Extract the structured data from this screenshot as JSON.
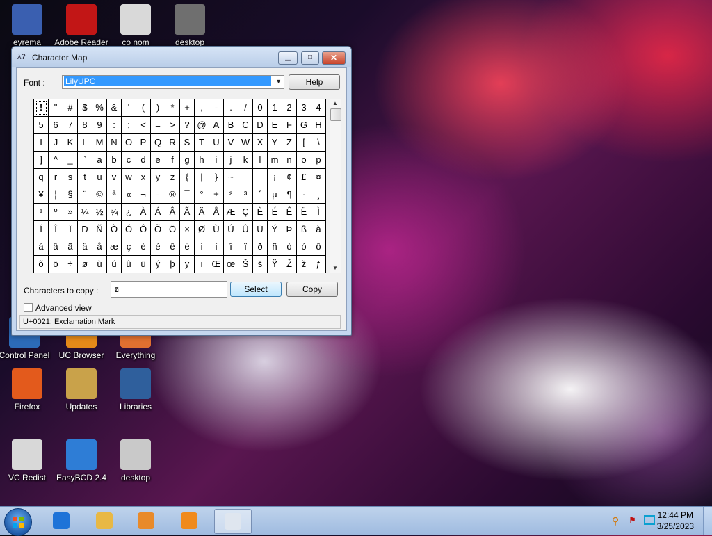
{
  "desktop": {
    "icons": [
      {
        "label": "eyrema",
        "color": "#3a5fb0"
      },
      {
        "label": "Adobe Reader",
        "color": "#c21616"
      },
      {
        "label": "co nom",
        "color": "#d9d9d9"
      },
      {
        "label": "desktop",
        "color": "#6f6f6f"
      },
      {
        "label": "Control Panel",
        "color": "#2c6bb8"
      },
      {
        "label": "UC Browser",
        "color": "#e58a19"
      },
      {
        "label": "Everything",
        "color": "#e07030"
      },
      {
        "label": "Firefox",
        "color": "#e35a1c"
      },
      {
        "label": "Updates",
        "color": "#c9a24a"
      },
      {
        "label": "Libraries",
        "color": "#2f5f9c"
      },
      {
        "label": "VC Redist",
        "color": "#d8d8d8"
      },
      {
        "label": "EasyBCD 2.4",
        "color": "#2e7dd6"
      },
      {
        "label": "desktop",
        "color": "#c9c9c9"
      }
    ]
  },
  "window": {
    "title": "Character Map",
    "icon_glyph": "λ?",
    "controls": {
      "minimize": "▁",
      "maximize": "□",
      "close": "✕"
    },
    "font_label": "Font :",
    "font_value": "LilyUPC",
    "help_label": "Help",
    "chars": [
      [
        "!",
        "\"",
        "#",
        "$",
        "%",
        "&",
        "'",
        "(",
        ")",
        "*",
        "+",
        ",",
        "-",
        ".",
        "/",
        "0",
        "1",
        "2",
        "3",
        "4"
      ],
      [
        "5",
        "6",
        "7",
        "8",
        "9",
        ":",
        ";",
        "<",
        "=",
        ">",
        "?",
        "@",
        "A",
        "B",
        "C",
        "D",
        "E",
        "F",
        "G",
        "H"
      ],
      [
        "I",
        "J",
        "K",
        "L",
        "M",
        "N",
        "O",
        "P",
        "Q",
        "R",
        "S",
        "T",
        "U",
        "V",
        "W",
        "X",
        "Y",
        "Z",
        "[",
        "\\"
      ],
      [
        "]",
        "^",
        "_",
        "`",
        "a",
        "b",
        "c",
        "d",
        "e",
        "f",
        "g",
        "h",
        "i",
        "j",
        "k",
        "l",
        "m",
        "n",
        "o",
        "p"
      ],
      [
        "q",
        "r",
        "s",
        "t",
        "u",
        "v",
        "w",
        "x",
        "y",
        "z",
        "{",
        "|",
        "}",
        "~",
        "",
        "",
        "¡",
        "¢",
        "£",
        "¤"
      ],
      [
        "¥",
        "¦",
        "§",
        "¨",
        "©",
        "ª",
        "«",
        "¬",
        "-",
        "®",
        "¯",
        "°",
        "±",
        "²",
        "³",
        "´",
        "µ",
        "¶",
        "·",
        "¸"
      ],
      [
        "¹",
        "º",
        "»",
        "¼",
        "½",
        "¾",
        "¿",
        "À",
        "Á",
        "Â",
        "Ã",
        "Ä",
        "Å",
        "Æ",
        "Ç",
        "È",
        "É",
        "Ê",
        "Ë",
        "Ì"
      ],
      [
        "Í",
        "Î",
        "Ï",
        "Ð",
        "Ñ",
        "Ò",
        "Ó",
        "Ô",
        "Õ",
        "Ö",
        "×",
        "Ø",
        "Ù",
        "Ú",
        "Û",
        "Ü",
        "Ý",
        "Þ",
        "ß",
        "à"
      ],
      [
        "á",
        "â",
        "ã",
        "ä",
        "å",
        "æ",
        "ç",
        "è",
        "é",
        "ê",
        "ë",
        "ì",
        "í",
        "î",
        "ï",
        "ð",
        "ñ",
        "ò",
        "ó",
        "ô"
      ],
      [
        "õ",
        "ö",
        "÷",
        "ø",
        "ù",
        "ú",
        "û",
        "ü",
        "ý",
        "þ",
        "ÿ",
        "ı",
        "Œ",
        "œ",
        "Š",
        "š",
        "Ÿ",
        "Ž",
        "ž",
        "ƒ"
      ]
    ],
    "copy_label": "Characters to copy :",
    "copy_value": "ฮ",
    "select_label": "Select",
    "copy_button_label": "Copy",
    "advanced_label": "Advanced view",
    "advanced_checked": false,
    "status": "U+0021: Exclamation Mark"
  },
  "taskbar": {
    "apps": [
      {
        "name": "Internet Explorer",
        "color": "#1e73d8"
      },
      {
        "name": "Windows Explorer",
        "color": "#e8b845"
      },
      {
        "name": "Media Player",
        "color": "#e88a2a"
      },
      {
        "name": "UC Browser",
        "color": "#f08a1c"
      },
      {
        "name": "Character Map",
        "color": "#dfe6ef",
        "active": true
      }
    ],
    "clock_time": "12:44 PM",
    "clock_date": "3/25/2023"
  }
}
